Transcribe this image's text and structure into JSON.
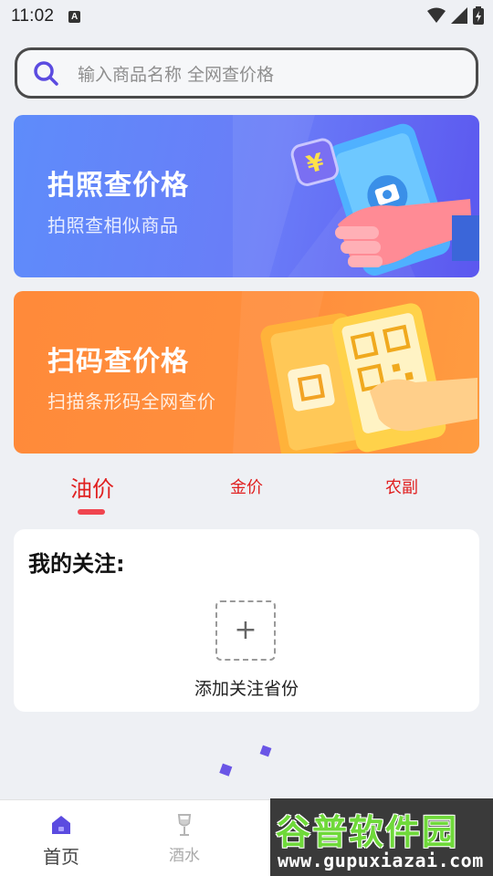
{
  "status_bar": {
    "time": "11:02",
    "notification_badge": "A"
  },
  "search": {
    "placeholder": "输入商品名称 全网查价格"
  },
  "banners": [
    {
      "title": "拍照查价格",
      "subtitle": "拍照查相似商品"
    },
    {
      "title": "扫码查价格",
      "subtitle": "扫描条形码全网查价"
    }
  ],
  "tabs": [
    {
      "label": "油价",
      "active": true
    },
    {
      "label": "金价",
      "active": false
    },
    {
      "label": "农副",
      "active": false
    }
  ],
  "follow": {
    "title": "我的关注:",
    "add_label": "添加关注省份"
  },
  "bottom_nav": [
    {
      "label": "首页",
      "icon": "home-icon",
      "active": true
    },
    {
      "label": "酒水",
      "icon": "wine-glass-icon",
      "active": false
    }
  ],
  "watermark": {
    "title": "谷普软件园",
    "url": "www.gupuxiazai.com"
  },
  "colors": {
    "accent_red": "#e02020",
    "photo_banner": "#5e8cfa",
    "scan_banner": "#ff8a3a",
    "brand_purple": "#5b4be0"
  }
}
